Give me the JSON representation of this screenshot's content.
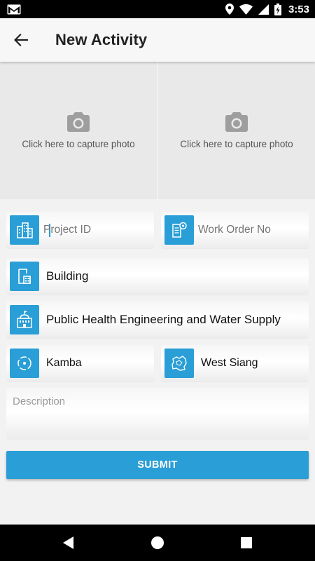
{
  "status_bar": {
    "time": "3:53"
  },
  "app_bar": {
    "title": "New Activity"
  },
  "photos": [
    {
      "label": "Click here to capture photo"
    },
    {
      "label": "Click here to capture photo"
    }
  ],
  "form": {
    "project_id": {
      "placeholder": "Project ID",
      "value": ""
    },
    "work_order": {
      "placeholder": "Work Order No",
      "value": ""
    },
    "category": {
      "value": "Building"
    },
    "department": {
      "value": "Public Health Engineering and Water Supply"
    },
    "location": {
      "value": "Kamba"
    },
    "district": {
      "value": "West Siang"
    },
    "description": {
      "placeholder": "Description",
      "value": ""
    },
    "submit_label": "SUBMIT"
  },
  "colors": {
    "accent": "#2a9ed6",
    "background": "#f2f2f2",
    "photo_bg": "#e9e9e9"
  },
  "icons": {
    "project_id": "buildings-icon",
    "work_order": "document-gear-icon",
    "category": "building-plan-icon",
    "department": "government-building-icon",
    "location": "location-circle-icon",
    "district": "map-region-icon",
    "camera": "camera-icon"
  }
}
